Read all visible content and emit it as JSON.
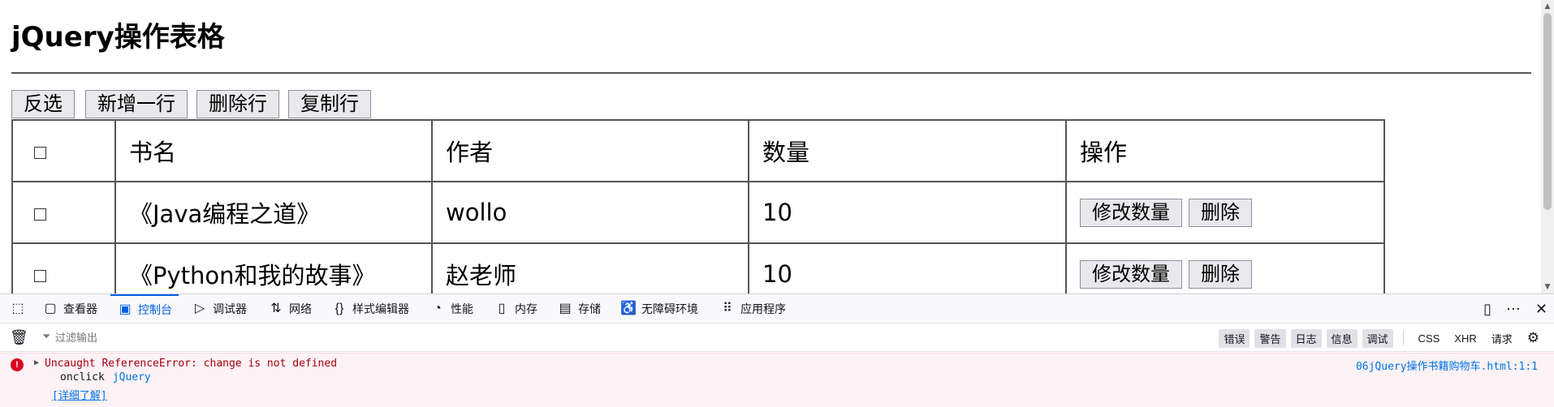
{
  "page": {
    "title": "jQuery操作表格",
    "buttons": {
      "invert": "反选",
      "add_row": "新增一行",
      "delete_row": "删除行",
      "copy_row": "复制行"
    },
    "table": {
      "headers": {
        "checkbox": "☐",
        "name": "书名",
        "author": "作者",
        "qty": "数量",
        "ops": "操作"
      },
      "rows": [
        {
          "name": "《Java编程之道》",
          "author": "wollo",
          "qty": "10",
          "btn_edit": "修改数量",
          "btn_del": "删除"
        },
        {
          "name": "《Python和我的故事》",
          "author": "赵老师",
          "qty": "10",
          "btn_edit": "修改数量",
          "btn_del": "删除"
        }
      ]
    }
  },
  "devtools": {
    "tabs": {
      "inspector": "查看器",
      "console": "控制台",
      "debugger": "调试器",
      "network": "网络",
      "style_editor": "样式编辑器",
      "performance": "性能",
      "memory": "内存",
      "storage": "存储",
      "accessibility": "无障碍环境",
      "application": "应用程序"
    },
    "filter_placeholder": "过滤输出",
    "levels": {
      "errors": "错误",
      "warnings": "警告",
      "logs": "日志",
      "info": "信息",
      "debug": "调试",
      "css": "CSS",
      "xhr": "XHR",
      "requests": "请求"
    },
    "error": {
      "message": "Uncaught ReferenceError: change is not defined",
      "source": "06jQuery操作书籍购物车.html:1:1",
      "trace_event": "onclick",
      "trace_lib": "jQuery",
      "learn_more": "[详细了解]"
    },
    "colors": {
      "accent": "#0061e0",
      "error": "#d70022",
      "error_bg": "#fdf2f5"
    }
  }
}
